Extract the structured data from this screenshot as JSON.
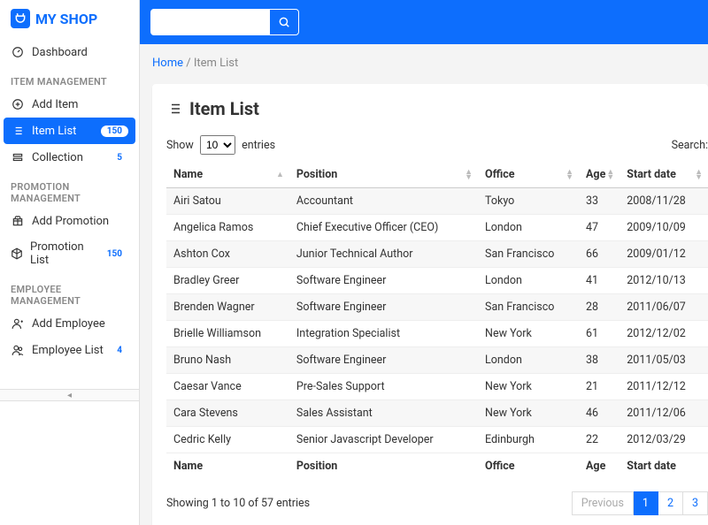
{
  "brand": "MY SHOP",
  "sidebar": {
    "dashboard": "Dashboard",
    "sections": {
      "item": "ITEM MANAGEMENT",
      "promo": "PROMOTION MANAGEMENT",
      "emp": "EMPLOYEE MANAGEMENT"
    },
    "addItem": "Add Item",
    "itemList": "Item List",
    "itemListBadge": "150",
    "collection": "Collection",
    "collectionBadge": "5",
    "addPromo": "Add Promotion",
    "promoList": "Promotion List",
    "promoListBadge": "150",
    "addEmp": "Add Employee",
    "empList": "Employee List",
    "empListBadge": "4"
  },
  "breadcrumb": {
    "home": "Home",
    "current": "Item List"
  },
  "page": {
    "title": "Item List"
  },
  "table": {
    "showLabel": "Show",
    "entriesLabel": "entries",
    "pageSize": "10",
    "searchLabel": "Search:",
    "columns": [
      "Name",
      "Position",
      "Office",
      "Age",
      "Start date"
    ],
    "rows": [
      [
        "Airi Satou",
        "Accountant",
        "Tokyo",
        "33",
        "2008/11/28"
      ],
      [
        "Angelica Ramos",
        "Chief Executive Officer (CEO)",
        "London",
        "47",
        "2009/10/09"
      ],
      [
        "Ashton Cox",
        "Junior Technical Author",
        "San Francisco",
        "66",
        "2009/01/12"
      ],
      [
        "Bradley Greer",
        "Software Engineer",
        "London",
        "41",
        "2012/10/13"
      ],
      [
        "Brenden Wagner",
        "Software Engineer",
        "San Francisco",
        "28",
        "2011/06/07"
      ],
      [
        "Brielle Williamson",
        "Integration Specialist",
        "New York",
        "61",
        "2012/12/02"
      ],
      [
        "Bruno Nash",
        "Software Engineer",
        "London",
        "38",
        "2011/05/03"
      ],
      [
        "Caesar Vance",
        "Pre-Sales Support",
        "New York",
        "21",
        "2011/12/12"
      ],
      [
        "Cara Stevens",
        "Sales Assistant",
        "New York",
        "46",
        "2011/12/06"
      ],
      [
        "Cedric Kelly",
        "Senior Javascript Developer",
        "Edinburgh",
        "22",
        "2012/03/29"
      ]
    ],
    "info": "Showing 1 to 10 of 57 entries",
    "pagination": {
      "prev": "Previous",
      "pages": [
        "1",
        "2",
        "3"
      ],
      "active": 0
    }
  }
}
